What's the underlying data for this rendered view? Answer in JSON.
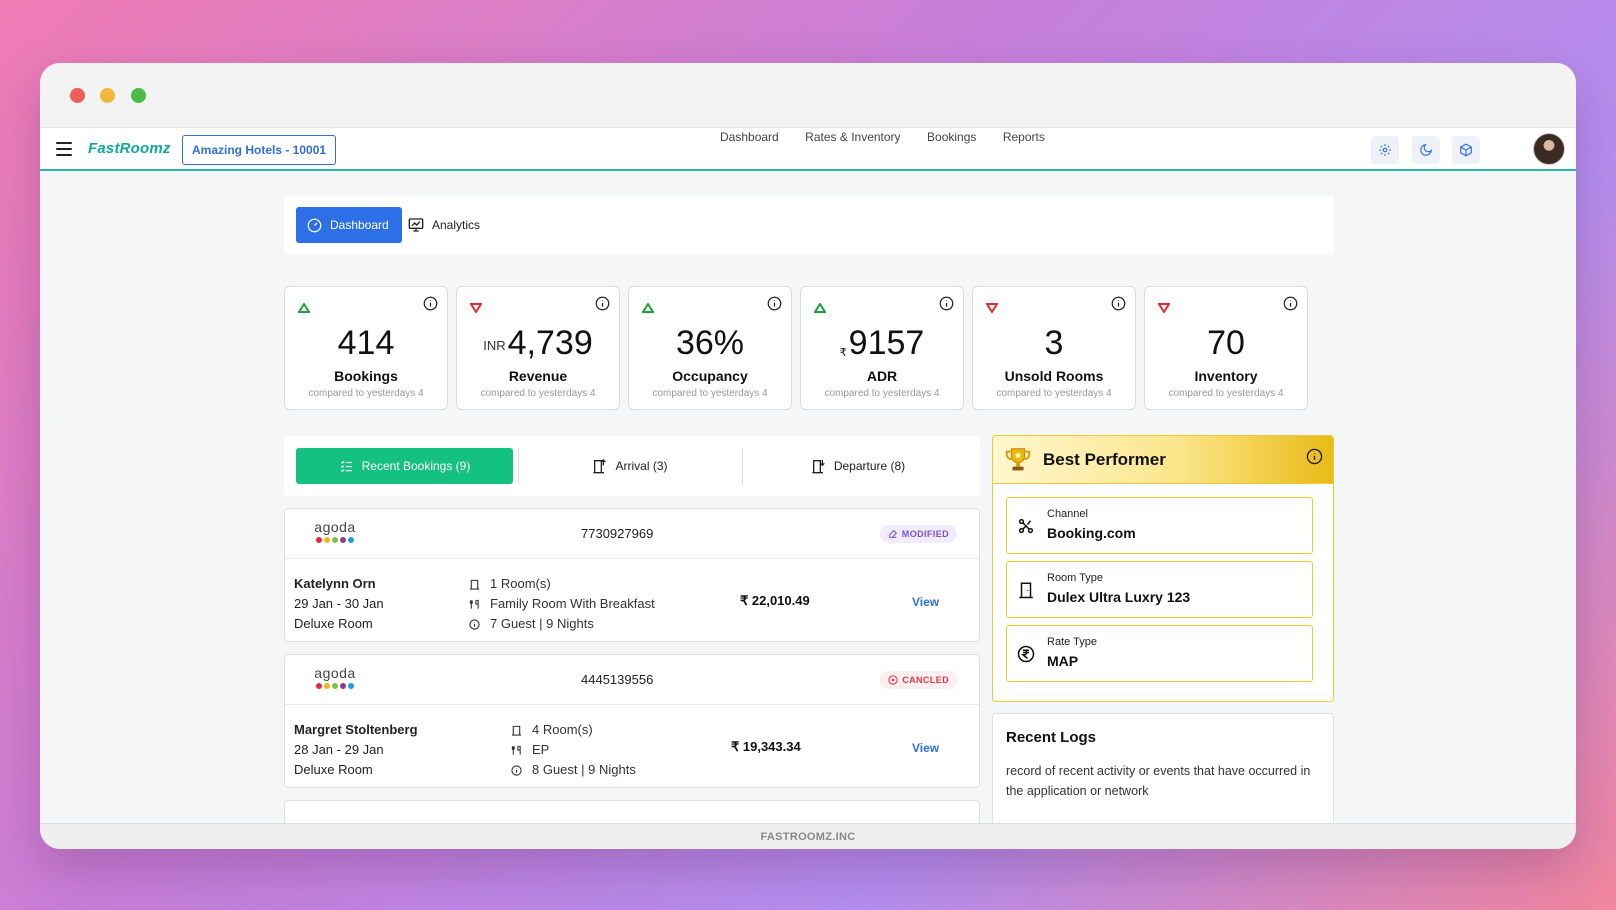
{
  "app": {
    "logo": "FastRoomz",
    "hotel": "Amazing Hotels - 10001"
  },
  "nav": {
    "links": [
      "Dashboard",
      "Rates & Inventory",
      "Bookings",
      "Reports"
    ]
  },
  "tabs": {
    "dashboard": "Dashboard",
    "analytics": "Analytics"
  },
  "stats": [
    {
      "trend": "up",
      "prefix": "",
      "value": "414",
      "label": "Bookings",
      "sub": "compared to yesterdays 4"
    },
    {
      "trend": "down",
      "prefix": "INR",
      "value": "4,739",
      "label": "Revenue",
      "sub": "compared to yesterdays 4"
    },
    {
      "trend": "up",
      "prefix": "",
      "value": "36%",
      "label": "Occupancy",
      "sub": "compared to yesterdays 4"
    },
    {
      "trend": "up",
      "prefix": "₹",
      "value": "9157",
      "label": "ADR",
      "sub": "compared to yesterdays 4"
    },
    {
      "trend": "down",
      "prefix": "",
      "value": "3",
      "label": "Unsold Rooms",
      "sub": "compared to yesterdays 4"
    },
    {
      "trend": "down",
      "prefix": "",
      "value": "70",
      "label": "Inventory",
      "sub": "compared to yesterdays 4"
    }
  ],
  "list_tabs": {
    "recent": "Recent Bookings (9)",
    "arrival": "Arrival (3)",
    "departure": "Departure (8)"
  },
  "bookings": [
    {
      "source": "agoda",
      "id": "7730927969",
      "status": "MODIFIED",
      "guest": "Katelynn Orn",
      "dates": "29 Jan - 30 Jan",
      "room": "Deluxe Room",
      "rooms": "1 Room(s)",
      "plan": "Family Room With Breakfast",
      "guests": "7 Guest | 9 Nights",
      "amount": "₹ 22,010.49",
      "view": "View"
    },
    {
      "source": "agoda",
      "id": "4445139556",
      "status": "CANCLED",
      "guest": "Margret Stoltenberg",
      "dates": "28 Jan - 29 Jan",
      "room": "Deluxe Room",
      "rooms": "4 Room(s)",
      "plan": "EP",
      "guests": "8 Guest | 9 Nights",
      "amount": "₹ 19,343.34",
      "view": "View"
    }
  ],
  "best": {
    "title": "Best Performer",
    "items": [
      {
        "label": "Channel",
        "value": "Booking.com",
        "icon": "channel-icon"
      },
      {
        "label": "Room Type",
        "value": "Dulex Ultra Luxry 123",
        "icon": "door-icon"
      },
      {
        "label": "Rate Type",
        "value": "MAP",
        "icon": "rupee-icon"
      }
    ]
  },
  "logs": {
    "title": "Recent Logs",
    "desc": "record of recent activity or events that have occurred in the application or network"
  },
  "footer": "FASTROOMZ.INC",
  "colors": {
    "primary": "#2d6fe6",
    "green": "#14c181",
    "gold": "#f0c832",
    "teal": "#2bb8a3"
  }
}
